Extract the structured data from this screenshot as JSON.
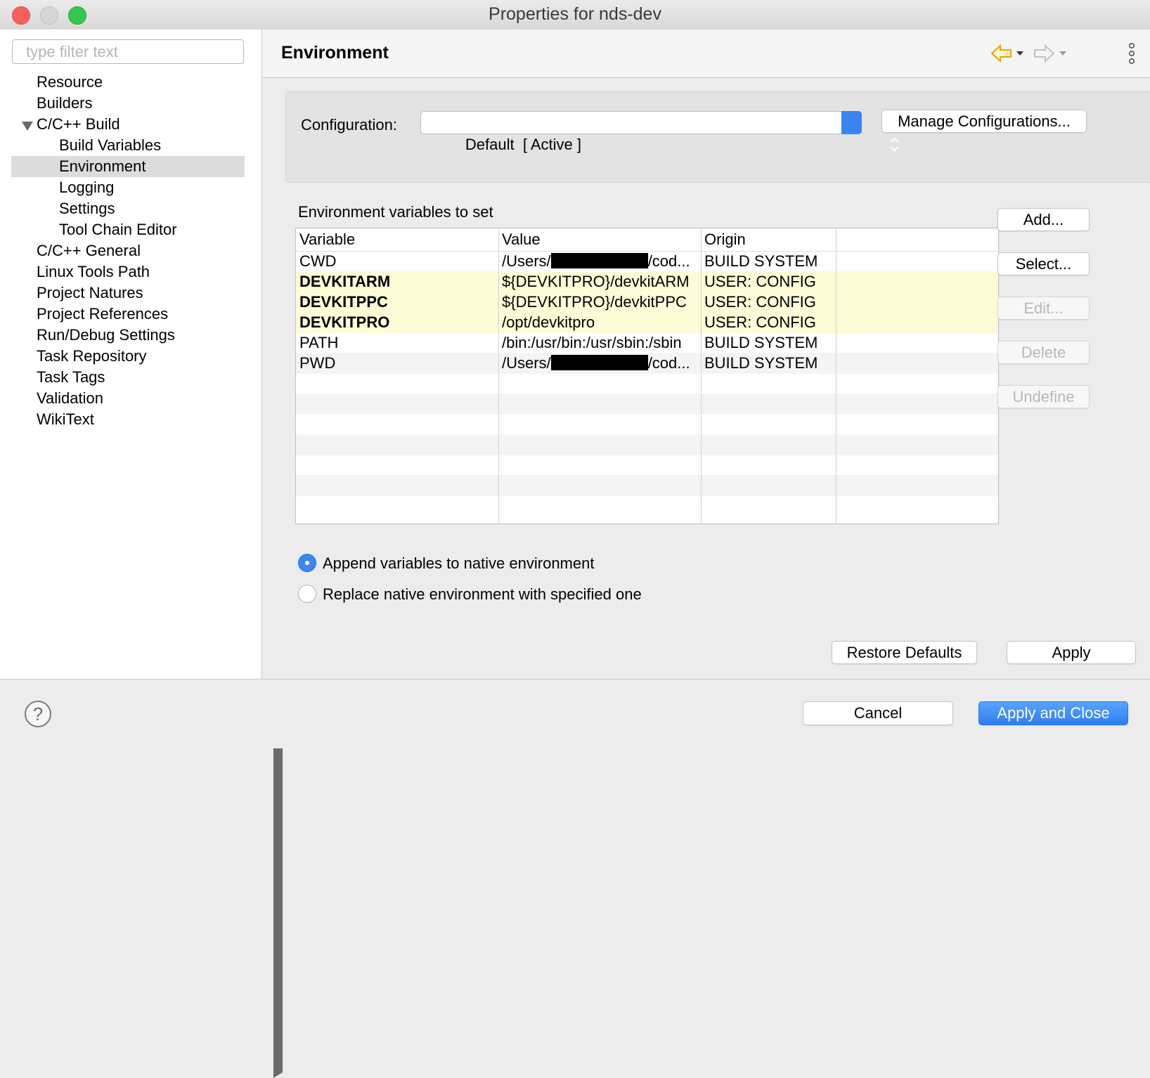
{
  "window": {
    "title": "Properties for nds-dev"
  },
  "sidebar": {
    "filter_placeholder": "type filter text",
    "items": [
      {
        "label": "Resource",
        "level": 0,
        "expander": "collapsed"
      },
      {
        "label": "Builders",
        "level": 0,
        "expander": "none"
      },
      {
        "label": "C/C++ Build",
        "level": 0,
        "expander": "expanded"
      },
      {
        "label": "Build Variables",
        "level": 1,
        "expander": "none"
      },
      {
        "label": "Environment",
        "level": 1,
        "expander": "none",
        "selected": true
      },
      {
        "label": "Logging",
        "level": 1,
        "expander": "none"
      },
      {
        "label": "Settings",
        "level": 1,
        "expander": "none"
      },
      {
        "label": "Tool Chain Editor",
        "level": 1,
        "expander": "none"
      },
      {
        "label": "C/C++ General",
        "level": 0,
        "expander": "collapsed"
      },
      {
        "label": "Linux Tools Path",
        "level": 0,
        "expander": "none"
      },
      {
        "label": "Project Natures",
        "level": 0,
        "expander": "none"
      },
      {
        "label": "Project References",
        "level": 0,
        "expander": "none"
      },
      {
        "label": "Run/Debug Settings",
        "level": 0,
        "expander": "none"
      },
      {
        "label": "Task Repository",
        "level": 0,
        "expander": "collapsed"
      },
      {
        "label": "Task Tags",
        "level": 0,
        "expander": "none"
      },
      {
        "label": "Validation",
        "level": 0,
        "expander": "collapsed"
      },
      {
        "label": "WikiText",
        "level": 0,
        "expander": "none"
      }
    ]
  },
  "header": {
    "title": "Environment",
    "icons": {
      "back": "back-arrow-icon",
      "forward": "forward-arrow-icon",
      "menu": "vertical-dots-icon"
    },
    "colors": {
      "back_arrow": "#e8a400"
    }
  },
  "configuration": {
    "label": "Configuration:",
    "selected": "Default  [ Active ]",
    "manage_button": "Manage Configurations..."
  },
  "env": {
    "section_label": "Environment variables to set",
    "columns": [
      "Variable",
      "Value",
      "Origin"
    ],
    "rows": [
      {
        "variable": "CWD",
        "value_prefix": "/Users/",
        "redacted": true,
        "value_suffix": "/cod...",
        "origin": "BUILD SYSTEM",
        "user": false
      },
      {
        "variable": "DEVKITARM",
        "value_prefix": "${DEVKITPRO}/devkitARM",
        "redacted": false,
        "value_suffix": "",
        "origin": "USER: CONFIG",
        "user": true
      },
      {
        "variable": "DEVKITPPC",
        "value_prefix": "${DEVKITPRO}/devkitPPC",
        "redacted": false,
        "value_suffix": "",
        "origin": "USER: CONFIG",
        "user": true
      },
      {
        "variable": "DEVKITPRO",
        "value_prefix": "/opt/devkitpro",
        "redacted": false,
        "value_suffix": "",
        "origin": "USER: CONFIG",
        "user": true
      },
      {
        "variable": "PATH",
        "value_prefix": "/bin:/usr/bin:/usr/sbin:/sbin",
        "redacted": false,
        "value_suffix": "",
        "origin": "BUILD SYSTEM",
        "user": false
      },
      {
        "variable": "PWD",
        "value_prefix": "/Users/",
        "redacted": true,
        "value_suffix": "/cod...",
        "origin": "BUILD SYSTEM",
        "user": false
      }
    ],
    "buttons": {
      "add": "Add...",
      "select": "Select...",
      "edit": "Edit...",
      "delete": "Delete",
      "undefine": "Undefine"
    },
    "radio": {
      "append": "Append variables to native environment",
      "replace": "Replace native environment with specified one",
      "selected": "append"
    },
    "colors": {
      "user_row_bg": "#fdfcd7"
    }
  },
  "page_buttons": {
    "restore_defaults": "Restore Defaults",
    "apply": "Apply"
  },
  "footer": {
    "help_icon": "question-mark-icon",
    "cancel": "Cancel",
    "apply_close": "Apply and Close",
    "accent": "#2e7ef2"
  }
}
